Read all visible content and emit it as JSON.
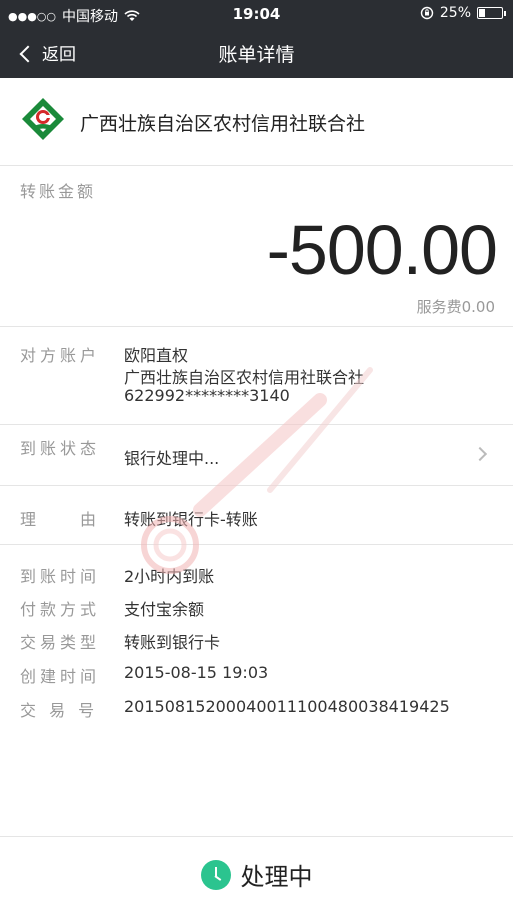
{
  "status_bar": {
    "carrier": "中国移动",
    "time": "19:04",
    "battery": "25%",
    "battery_level": 0.25
  },
  "nav": {
    "back_label": "返回",
    "title": "账单详情"
  },
  "bank": {
    "name": "广西壮族自治区农村信用社联合社"
  },
  "amount": {
    "label": "转账金额",
    "value": "-500.00",
    "service_fee": "服务费0.00"
  },
  "counterparty": {
    "label": "对方账户",
    "name": "欧阳直权",
    "bank": "广西壮族自治区农村信用社联合社",
    "account": "622992********3140"
  },
  "arrival_status": {
    "label": "到账状态",
    "value": "银行处理中..."
  },
  "reason": {
    "label": "理　　由",
    "value": "转账到银行卡-转账"
  },
  "details": [
    {
      "label": "到账时间",
      "value": "2小时内到账"
    },
    {
      "label": "付款方式",
      "value": "支付宝余额"
    },
    {
      "label": "交易类型",
      "value": "转账到银行卡"
    },
    {
      "label": "创建时间",
      "value": "2015-08-15 19:03"
    },
    {
      "label": "交 易 号",
      "value": "20150815200040011100480038419425"
    }
  ],
  "bottom": {
    "status": "处理中"
  },
  "colors": {
    "nav_bg": "#2b2e33",
    "bank_green": "#1a8a3a",
    "bank_red": "#d42a2a",
    "processing_green": "#2bc48f"
  }
}
